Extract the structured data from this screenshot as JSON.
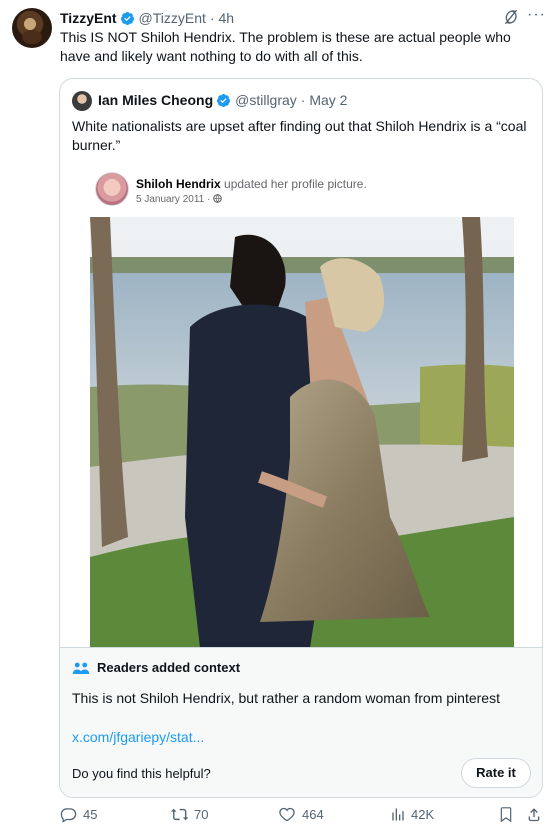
{
  "tweet": {
    "author_name": "TizzyEnt",
    "handle": "@TizzyEnt",
    "time": "· 4h",
    "text": "This IS NOT Shiloh Hendrix. The problem is these are actual people who have and likely want nothing to do with all of this."
  },
  "quote": {
    "author_name": "Ian Miles Cheong",
    "handle": "@stillgray",
    "time": "· May 2",
    "text": "White nationalists are upset after finding out that Shiloh Hendrix is a “coal burner.”",
    "fb_post": {
      "name": "Shiloh Hendrix",
      "action": "updated her profile picture.",
      "date": "5 January 2011 ·"
    }
  },
  "community_note": {
    "title": "Readers added context",
    "body": "This is not Shiloh Hendrix, but rather a random woman from pinterest",
    "link": "x.com/jfgariepy/stat...",
    "question": "Do you find this helpful?",
    "rate_label": "Rate it"
  },
  "actions": {
    "replies": "45",
    "reposts": "70",
    "likes": "464",
    "views": "42K"
  },
  "colors": {
    "accent": "#1d9bf0",
    "muted": "#536471",
    "border": "#cfd9de",
    "note_bg": "#f7f9f9"
  },
  "icons": [
    "grok-icon",
    "more-icon",
    "verified-badge-icon",
    "globe-icon",
    "readers-icon",
    "reply-icon",
    "repost-icon",
    "like-icon",
    "views-icon",
    "bookmark-icon",
    "share-icon"
  ]
}
